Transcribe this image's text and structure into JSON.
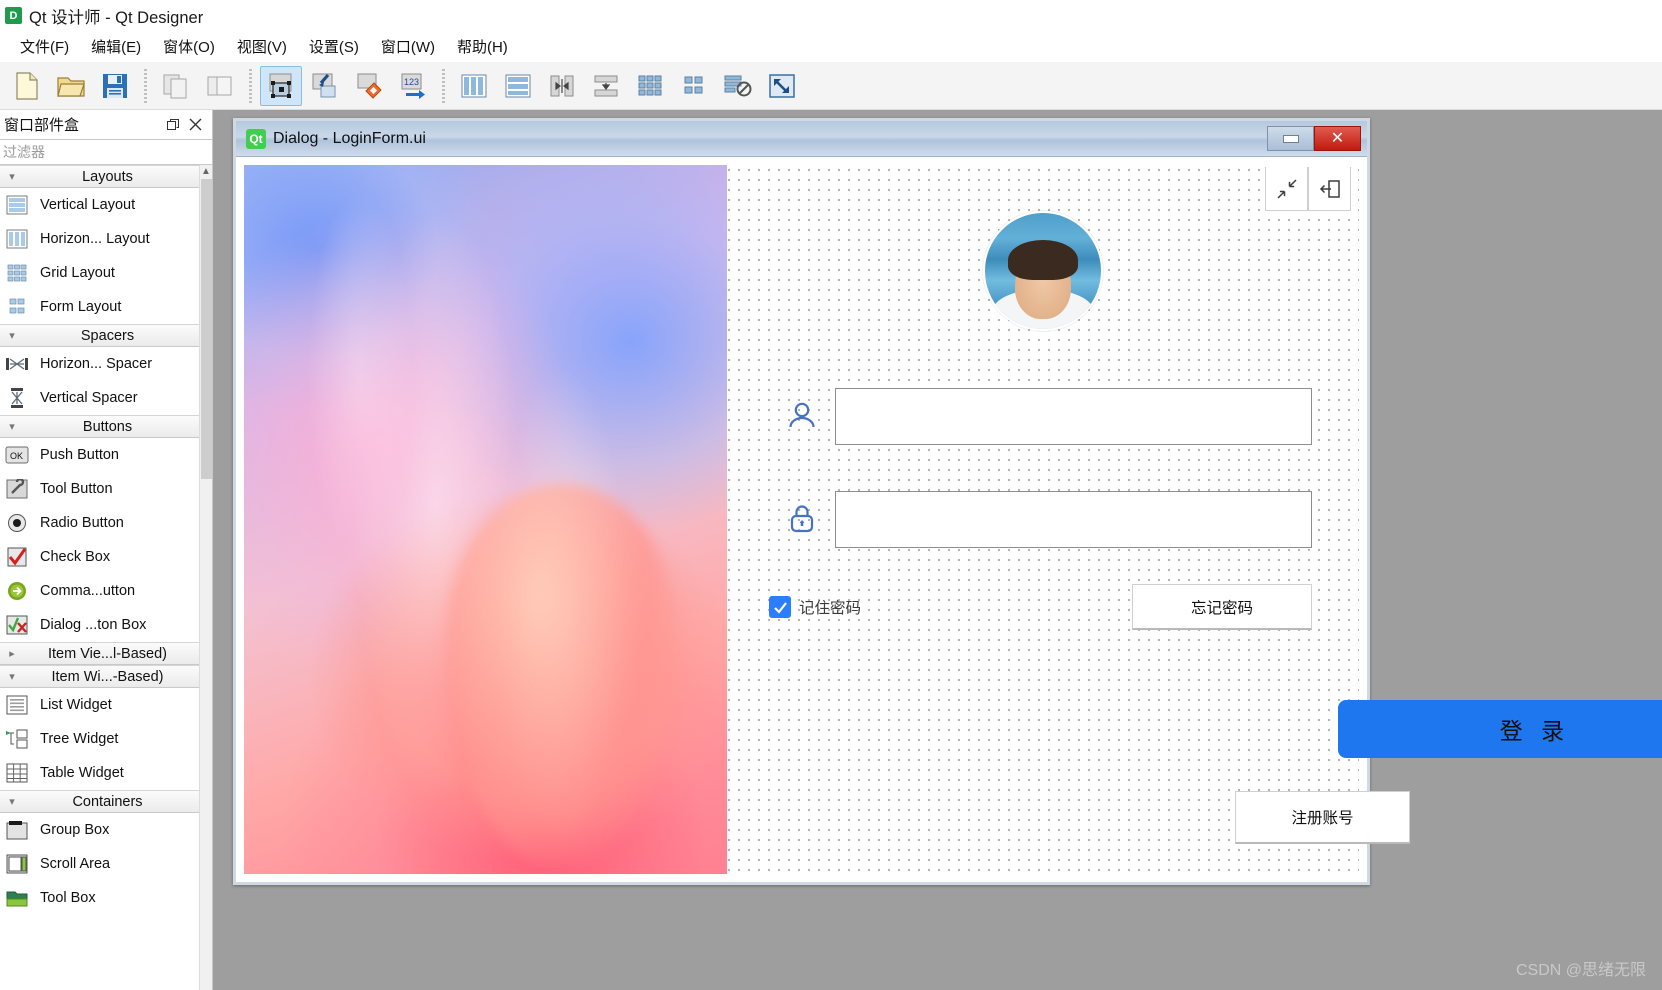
{
  "window": {
    "app_icon": "D",
    "title": "Qt 设计师 - Qt Designer"
  },
  "menubar": {
    "items": [
      {
        "label": "文件(F)",
        "name": "menu-file"
      },
      {
        "label": "编辑(E)",
        "name": "menu-edit"
      },
      {
        "label": "窗体(O)",
        "name": "menu-form"
      },
      {
        "label": "视图(V)",
        "name": "menu-view"
      },
      {
        "label": "设置(S)",
        "name": "menu-settings"
      },
      {
        "label": "窗口(W)",
        "name": "menu-window"
      },
      {
        "label": "帮助(H)",
        "name": "menu-help"
      }
    ]
  },
  "toolbar": {
    "groups": [
      [
        "new-file-icon",
        "open-file-icon",
        "save-file-icon"
      ],
      [
        "copy-icon",
        "paste-icon"
      ],
      [
        "edit-widgets-icon",
        "edit-signals-slots-icon",
        "edit-buddies-icon",
        "edit-tab-order-icon"
      ],
      [
        "layout-horizontally-icon",
        "layout-vertically-icon",
        "layout-splitter-horizontal-icon",
        "layout-splitter-vertical-icon",
        "layout-grid-icon",
        "layout-form-icon",
        "break-layout-icon",
        "adjust-size-icon"
      ]
    ]
  },
  "dock": {
    "title": "窗口部件盒",
    "float_icon": "float-icon",
    "close_icon": "close-icon",
    "filter_placeholder": "过滤器",
    "filter_value": "",
    "groups": [
      {
        "label": "Layouts",
        "expanded": true,
        "chevron": "chevron-down-icon",
        "items": [
          {
            "label": "Vertical Layout",
            "icon": "vertical-layout-icon"
          },
          {
            "label": "Horizon... Layout",
            "icon": "horizontal-layout-icon"
          },
          {
            "label": "Grid Layout",
            "icon": "grid-layout-icon"
          },
          {
            "label": "Form Layout",
            "icon": "form-layout-icon"
          }
        ]
      },
      {
        "label": "Spacers",
        "expanded": true,
        "chevron": "chevron-down-icon",
        "items": [
          {
            "label": "Horizon... Spacer",
            "icon": "horizontal-spacer-icon"
          },
          {
            "label": "Vertical Spacer",
            "icon": "vertical-spacer-icon"
          }
        ]
      },
      {
        "label": "Buttons",
        "expanded": true,
        "chevron": "chevron-down-icon",
        "items": [
          {
            "label": "Push Button",
            "icon": "push-button-icon"
          },
          {
            "label": "Tool Button",
            "icon": "tool-button-icon"
          },
          {
            "label": "Radio Button",
            "icon": "radio-button-icon"
          },
          {
            "label": "Check Box",
            "icon": "check-box-icon"
          },
          {
            "label": "Comma...utton",
            "icon": "command-link-button-icon"
          },
          {
            "label": "Dialog ...ton Box",
            "icon": "dialog-button-box-icon"
          }
        ]
      },
      {
        "label": "Item Vie...l-Based)",
        "expanded": false,
        "chevron": "chevron-right-icon",
        "items": []
      },
      {
        "label": "Item Wi...-Based)",
        "expanded": true,
        "chevron": "chevron-down-icon",
        "items": [
          {
            "label": "List Widget",
            "icon": "list-widget-icon"
          },
          {
            "label": "Tree Widget",
            "icon": "tree-widget-icon"
          },
          {
            "label": "Table Widget",
            "icon": "table-widget-icon"
          }
        ]
      },
      {
        "label": "Containers",
        "expanded": true,
        "chevron": "chevron-down-icon",
        "items": [
          {
            "label": "Group Box",
            "icon": "group-box-icon"
          },
          {
            "label": "Scroll Area",
            "icon": "scroll-area-icon"
          },
          {
            "label": "Tool Box",
            "icon": "tool-box-icon"
          }
        ]
      }
    ]
  },
  "dialog": {
    "icon_text": "Qt",
    "title": "Dialog - LoginForm.ui",
    "minimize_icon": "minimize-icon",
    "close_icon": "close-icon",
    "form": {
      "hero_image": "abstract-hand-artwork",
      "top_buttons": [
        {
          "name": "collapse-button",
          "icon": "collapse-arrows-icon"
        },
        {
          "name": "exit-button",
          "icon": "exit-door-icon"
        }
      ],
      "avatar": "user-avatar-photo",
      "username": {
        "icon": "person-icon",
        "value": "",
        "placeholder": ""
      },
      "password": {
        "icon": "lock-icon",
        "value": "",
        "placeholder": ""
      },
      "remember": {
        "label": "记住密码",
        "checked": true,
        "check_icon": "check-icon"
      },
      "forgot_label": "忘记密码",
      "login_label": "登 录",
      "register_label": "注册账号"
    }
  },
  "watermark": "CSDN @思绪无限",
  "colors": {
    "accent_blue": "#1f77f0",
    "checkbox_blue": "#2b7fff",
    "icon_blue": "#4572c4",
    "titlebar_close_red": "#c31a0d",
    "qt_green": "#41cd52",
    "workspace_gray": "#9e9e9e"
  }
}
